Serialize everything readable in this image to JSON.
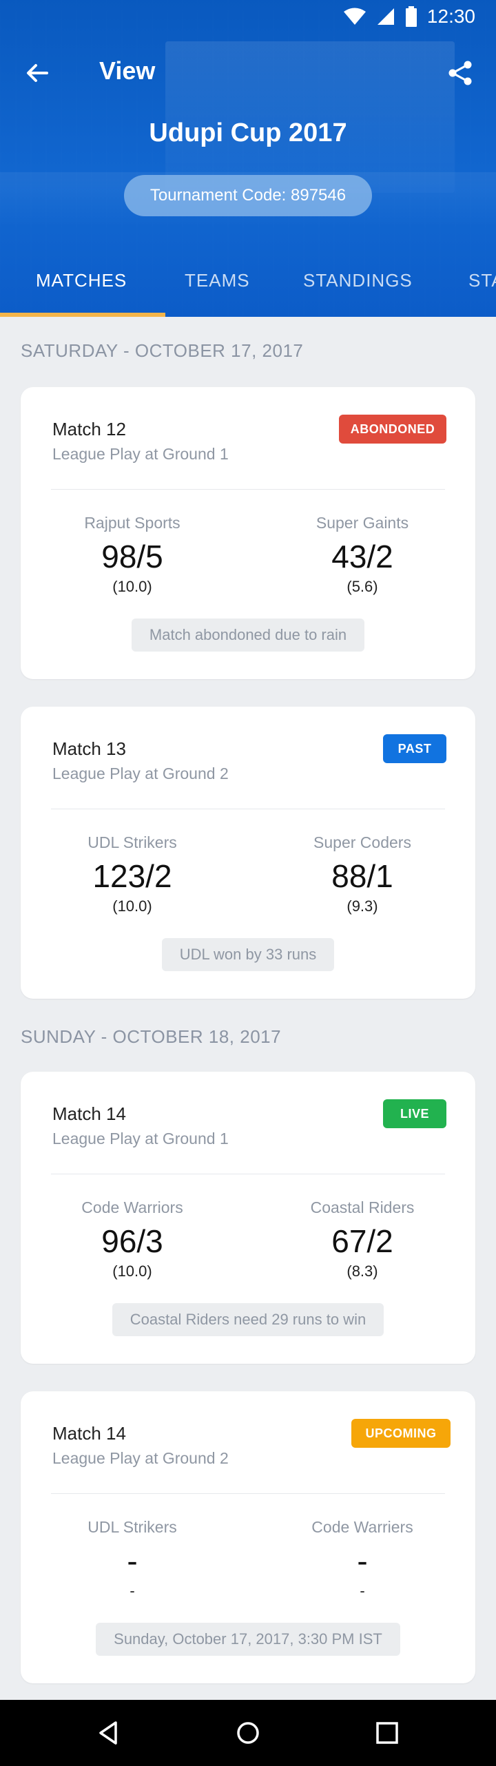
{
  "status_bar": {
    "time": "12:30"
  },
  "toolbar": {
    "title": "View"
  },
  "tournament": {
    "name": "Udupi Cup 2017",
    "code_label": "Tournament Code: 897546"
  },
  "tabs": [
    {
      "label": "MATCHES",
      "active": true
    },
    {
      "label": "TEAMS",
      "active": false
    },
    {
      "label": "STANDINGS",
      "active": false
    },
    {
      "label": "STA",
      "active": false
    }
  ],
  "sections": [
    {
      "date": "SATURDAY - OCTOBER 17, 2017",
      "matches": [
        {
          "title": "Match 12",
          "subtitle": "League Play at Ground 1",
          "badge": {
            "label": "ABONDONED",
            "color": "#e04b3c"
          },
          "team1": {
            "name": "Rajput Sports",
            "score": "98/5",
            "overs": "(10.0)"
          },
          "team2": {
            "name": "Super Gaints",
            "score": "43/2",
            "overs": "(5.6)"
          },
          "result": "Match abondoned due to rain"
        },
        {
          "title": "Match 13",
          "subtitle": "League Play at Ground 2",
          "badge": {
            "label": "PAST",
            "color": "#1173e0"
          },
          "team1": {
            "name": "UDL Strikers",
            "score": "123/2",
            "overs": "(10.0)"
          },
          "team2": {
            "name": "Super Coders",
            "score": "88/1",
            "overs": "(9.3)"
          },
          "result": "UDL won by 33 runs"
        }
      ]
    },
    {
      "date": "SUNDAY - OCTOBER 18, 2017",
      "matches": [
        {
          "title": "Match 14",
          "subtitle": "League Play at Ground 1",
          "badge": {
            "label": "LIVE",
            "color": "#22b24f"
          },
          "team1": {
            "name": "Code Warriors",
            "score": "96/3",
            "overs": "(10.0)"
          },
          "team2": {
            "name": "Coastal Riders",
            "score": "67/2",
            "overs": "(8.3)"
          },
          "result": "Coastal Riders need 29 runs to win"
        },
        {
          "title": "Match 14",
          "subtitle": "League Play at Ground 2",
          "badge": {
            "label": "UPCOMING",
            "color": "#f6a609"
          },
          "team1": {
            "name": "UDL Strikers",
            "score": "-",
            "overs": "-"
          },
          "team2": {
            "name": "Code Warriers",
            "score": "-",
            "overs": "-"
          },
          "result": "Sunday, October 17, 2017, 3:30 PM IST"
        }
      ]
    }
  ],
  "icons": {
    "back": "arrow-left-icon",
    "share": "share-icon",
    "wifi": "wifi-icon",
    "signal": "signal-icon",
    "battery": "battery-icon",
    "nav_back": "nav-back-icon",
    "nav_home": "nav-home-icon",
    "nav_recents": "nav-recents-icon"
  }
}
